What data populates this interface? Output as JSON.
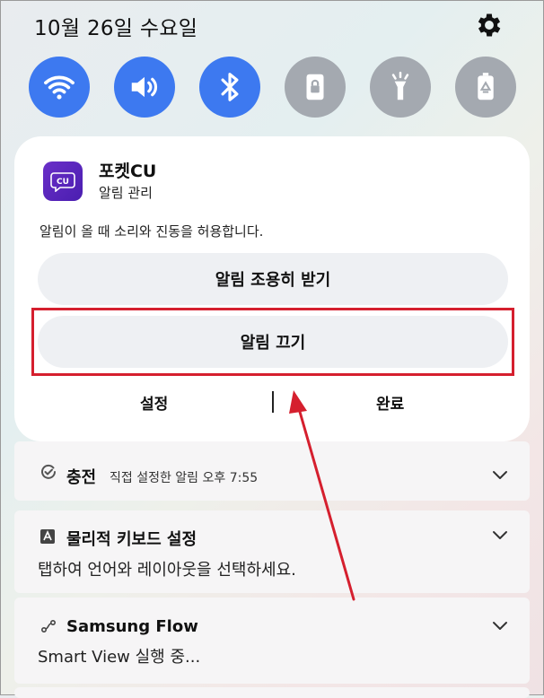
{
  "status": {
    "date": "10월 26일 수요일"
  },
  "toggles": [
    {
      "name": "wifi",
      "icon": "wifi-icon",
      "state": "on"
    },
    {
      "name": "sound",
      "icon": "volume-icon",
      "state": "on"
    },
    {
      "name": "bluetooth",
      "icon": "bluetooth-icon",
      "state": "on"
    },
    {
      "name": "lock",
      "icon": "lock-icon",
      "state": "off"
    },
    {
      "name": "flashlight",
      "icon": "flashlight-icon",
      "state": "off"
    },
    {
      "name": "battery",
      "icon": "battery-saver-icon",
      "state": "off"
    }
  ],
  "notification": {
    "app_icon_text": "CU",
    "app_name": "포켓CU",
    "app_subtitle": "알림 관리",
    "message": "알림이 올 때 소리와 진동을 허용합니다.",
    "quiet_button": "알림 조용히 받기",
    "off_button": "알림 끄기",
    "settings_label": "설정",
    "done_label": "완료"
  },
  "notifications": [
    {
      "title": "충전",
      "meta": "직접 설정한 알림  오후 7:55",
      "icon": "charging-icon"
    },
    {
      "title": "물리적 키보드 설정",
      "body": "탭하여 언어와 레이아웃을 선택하세요.",
      "icon": "keyboard-icon"
    },
    {
      "title": "Samsung Flow",
      "body": "Smart View 실행 중...",
      "icon": "samsung-flow-icon"
    }
  ],
  "colors": {
    "toggle_on": "#3d79f0",
    "toggle_off": "#a4a9b0",
    "highlight": "#d51f2e",
    "app_icon": "#5a25c0"
  }
}
